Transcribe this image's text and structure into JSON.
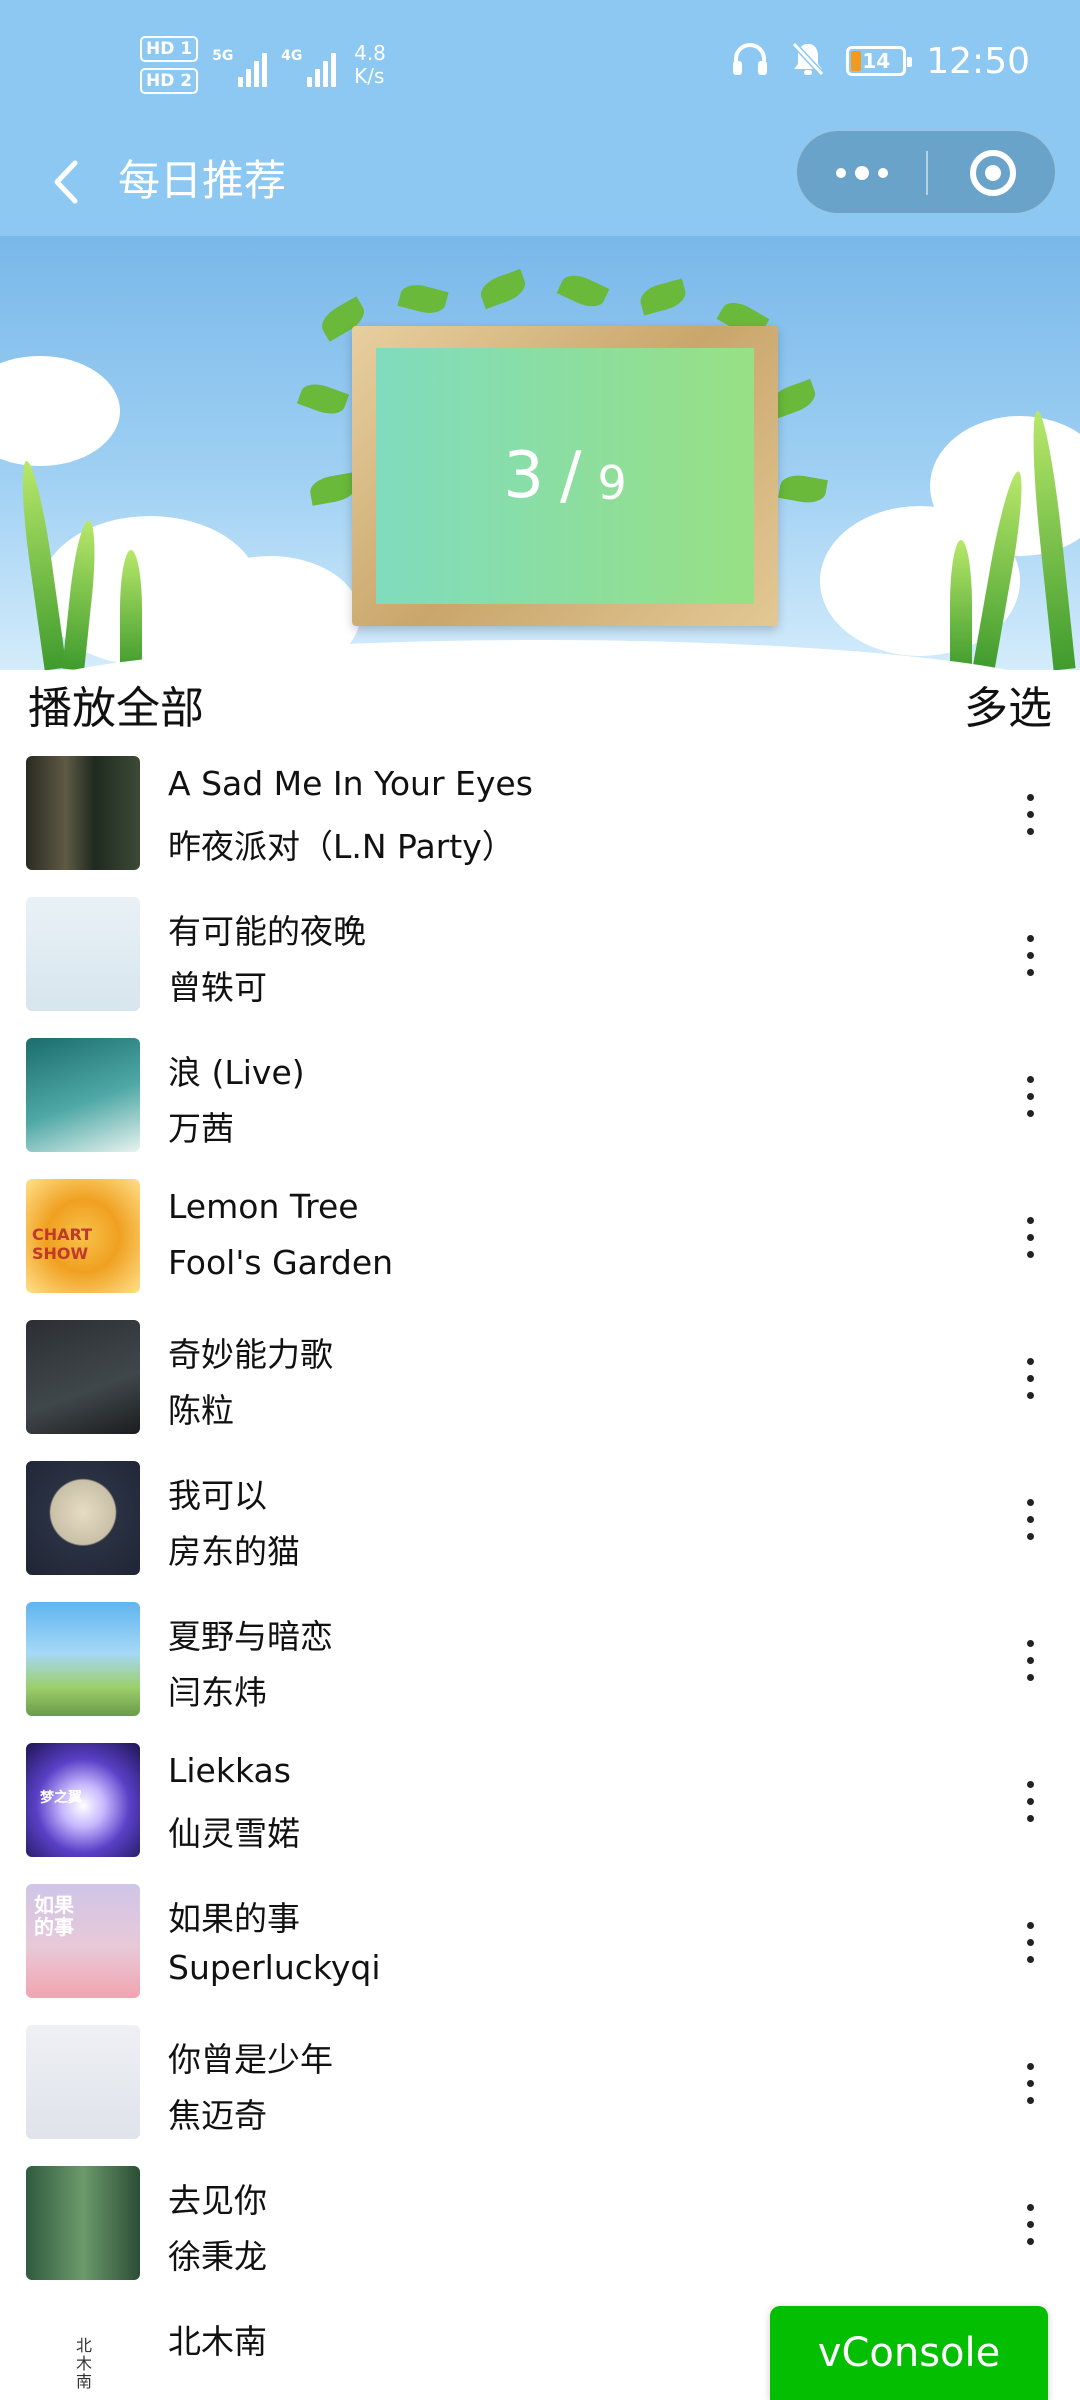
{
  "status_bar": {
    "hd_badges": [
      "HD 1",
      "HD 2"
    ],
    "signal_tags": [
      "5G",
      "4G"
    ],
    "net_speed_value": "4.8",
    "net_speed_unit": "K/s",
    "battery": "14",
    "time": "12:50",
    "icons": [
      "headphones-icon",
      "bell-off-icon",
      "battery-icon"
    ]
  },
  "nav": {
    "title": "每日推荐",
    "back_icon": "chevron-left-icon",
    "more_icon": "more-dots-icon",
    "close_icon": "target-circle-icon"
  },
  "banner": {
    "current": "3",
    "separator": "/",
    "total": "9"
  },
  "list_header": {
    "play_all": "播放全部",
    "multi_select": "多选"
  },
  "songs": [
    {
      "title": "A Sad Me In Your Eyes",
      "artist": "昨夜派对（L.N Party）"
    },
    {
      "title": "有可能的夜晚",
      "artist": "曾轶可"
    },
    {
      "title": "浪 (Live)",
      "artist": "万茜"
    },
    {
      "title": "Lemon Tree",
      "artist": "Fool's Garden"
    },
    {
      "title": "奇妙能力歌",
      "artist": "陈粒"
    },
    {
      "title": "我可以",
      "artist": "房东的猫"
    },
    {
      "title": "夏野与暗恋",
      "artist": "闫东炜"
    },
    {
      "title": "Liekkas",
      "artist": "仙灵雪婼"
    },
    {
      "title": "如果的事",
      "artist": "Superluckyqi"
    },
    {
      "title": "你曾是少年",
      "artist": "焦迈奇"
    },
    {
      "title": "去见你",
      "artist": "徐秉龙"
    },
    {
      "title": "北木南",
      "artist": ""
    }
  ],
  "cover_texts": {
    "c4": "CHART SHOW",
    "c8": "梦之翼",
    "c9": "如果的事",
    "c12": "北木南"
  },
  "colors": {
    "header_bg": "#8cc8f2",
    "vconsole_bg": "#04be02",
    "battery_fill": "#f39a1e"
  },
  "vconsole": {
    "label": "vConsole"
  }
}
